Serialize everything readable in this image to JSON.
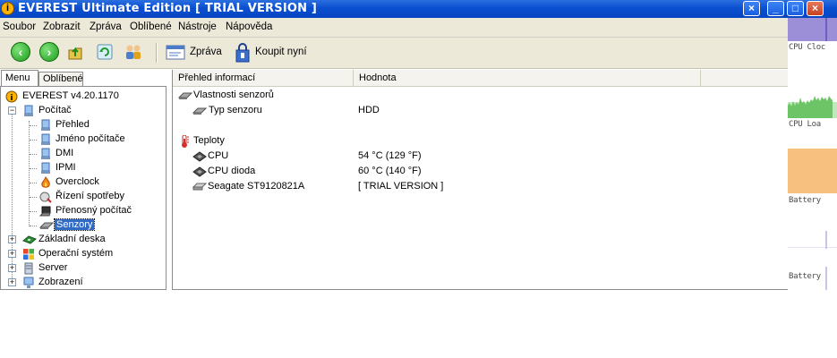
{
  "window": {
    "title": "EVEREST Ultimate Edition  [ TRIAL VERSION ]",
    "controls": {
      "close_main": "×",
      "minimize": "_",
      "maximize": "□",
      "close": "×"
    }
  },
  "menubar": {
    "items": [
      "Soubor",
      "Zobrazit",
      "Zpráva",
      "Oblíbené",
      "Nástroje",
      "Nápověda"
    ]
  },
  "toolbar": {
    "back": "‹",
    "forward": "›",
    "report_label": "Zpráva",
    "buy_label": "Koupit nyní"
  },
  "left_tabs": {
    "menu": "Menu",
    "favorites": "Oblíbené"
  },
  "tree": {
    "root": "EVEREST v4.20.1170",
    "computer": "Počítač",
    "children": [
      "Přehled",
      "Jméno počítače",
      "DMI",
      "IPMI",
      "Overclock",
      "Řízení spotřeby",
      "Přenosný počítač",
      "Senzory"
    ],
    "others": [
      "Základní deska",
      "Operační systém",
      "Server",
      "Zobrazení"
    ]
  },
  "columns": {
    "field": "Přehled informací",
    "value": "Hodnota"
  },
  "sections": {
    "sensor_props": {
      "title": "Vlastnosti senzorů",
      "rows": [
        {
          "field": "Typ senzoru",
          "value": "HDD"
        }
      ]
    },
    "temperatures": {
      "title": "Teploty",
      "rows": [
        {
          "field": "CPU",
          "value": "54 °C  (129 °F)"
        },
        {
          "field": "CPU dioda",
          "value": "60 °C  (140 °F)"
        },
        {
          "field": "Seagate ST9120821A",
          "value": "[ TRIAL VERSION ]"
        }
      ]
    }
  },
  "gadgets": {
    "cpu_clock": "CPU Cloc",
    "cpu_load": "CPU Loa",
    "battery1": "Battery",
    "battery2": "Battery"
  },
  "colors": {
    "titlebar": "#0a4fd0",
    "selection": "#316ac5",
    "gadget_purple": "#9c8fd8",
    "gadget_green": "#7fd17a",
    "gadget_orange": "#f7c07f"
  }
}
